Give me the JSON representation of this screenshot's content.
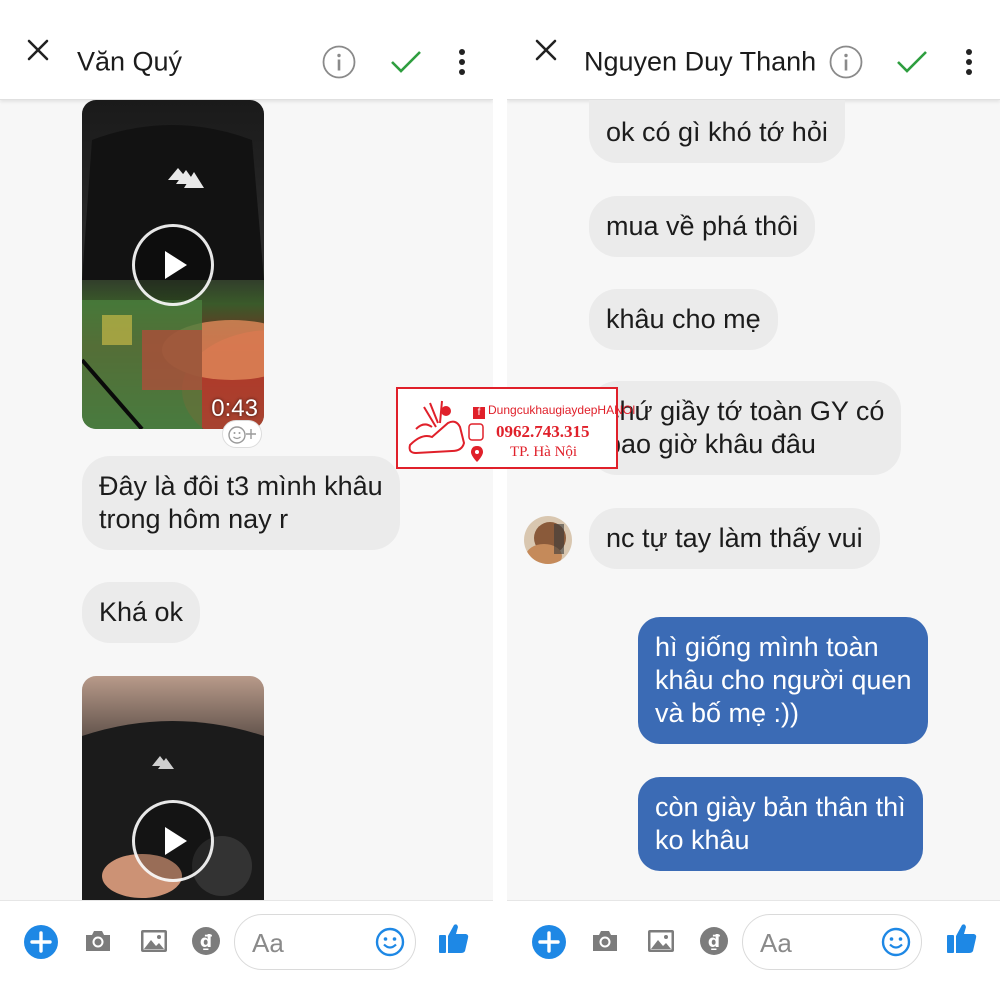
{
  "left_chat": {
    "title": "Văn Quý",
    "video1": {
      "duration": "0:43"
    },
    "messages": [
      {
        "text": "Đây là đôi t3 mình khâu\ntrong hôm nay r"
      },
      {
        "text": "Khá ok"
      }
    ],
    "composer": {
      "placeholder": "Aa"
    }
  },
  "right_chat": {
    "title": "Nguyen Duy Thanh",
    "incoming": [
      {
        "text": "ok có gì khó tớ hỏi"
      },
      {
        "text": "mua về phá thôi"
      },
      {
        "text": "khâu cho mẹ"
      },
      {
        "text": "chứ giầy tớ toàn GY có\nbao giờ khâu đâu"
      },
      {
        "text": "nc tự tay làm thấy vui"
      }
    ],
    "outgoing": [
      {
        "text": "hì giống mình toàn\nkhâu cho người quen\nvà bố mẹ :))"
      },
      {
        "text": "còn giày bản thân thì\nko khâu"
      }
    ],
    "composer": {
      "placeholder": "Aa"
    }
  },
  "watermark": {
    "facebook_badge": "f",
    "facebook_name": "DungcukhaugiaydepHANOI",
    "phone": "0962.743.315",
    "city": "TP. Hà Nội"
  },
  "colors": {
    "accent_blue": "#1e88e5",
    "outgoing_bubble": "#3b6bb5",
    "incoming_bubble": "#ebebeb",
    "check_green": "#2e9e3f",
    "watermark_red": "#e0202a"
  },
  "icons": {
    "close": "close-icon",
    "info": "info-icon",
    "check": "check-icon",
    "more": "more-vertical-icon",
    "plus": "plus-icon",
    "camera": "camera-icon",
    "gallery": "image-icon",
    "payment": "dong-payment-icon",
    "emoji": "emoji-icon",
    "like": "thumbs-up-icon",
    "play": "play-icon"
  }
}
